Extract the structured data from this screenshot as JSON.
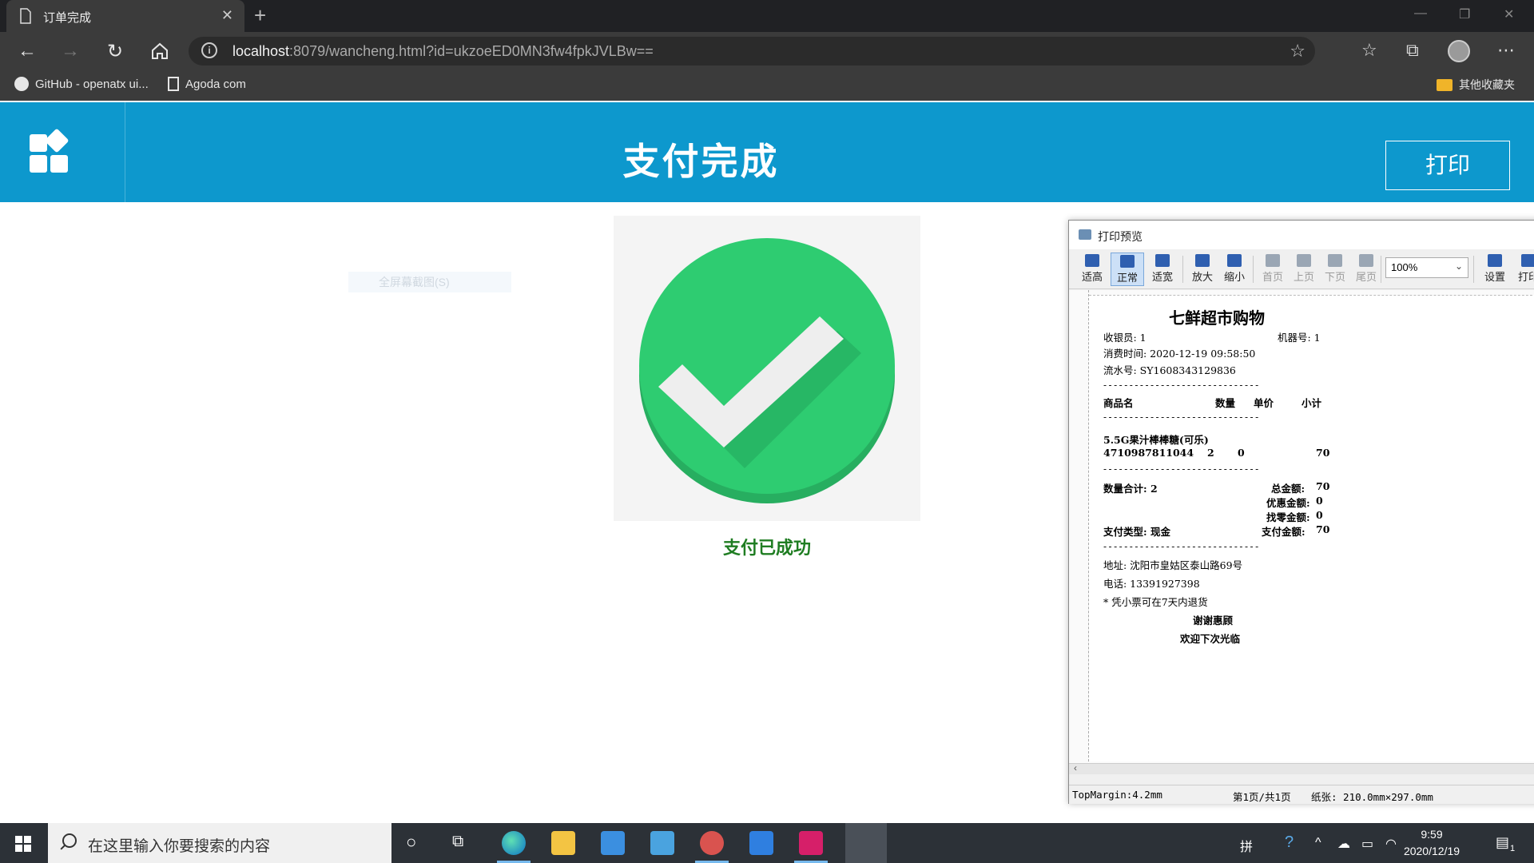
{
  "browser": {
    "tab_title": "订单完成",
    "url_host": "localhost",
    "url_rest": ":8079/wancheng.html?id=ukzoeED0MN3fw4fpkJVLBw==",
    "bookmarks": [
      "GitHub - openatx ui...",
      "Agoda com"
    ],
    "other_bookmarks": "其他收藏夹"
  },
  "page": {
    "title": "支付完成",
    "print_button": "打印",
    "faint_label": "全屏幕截图(S)",
    "success_message": "支付已成功",
    "colors": {
      "header": "#0d98cd",
      "check_green": "#2ecc71",
      "success_text": "#1f7d22"
    }
  },
  "print_preview": {
    "window_title": "打印预览",
    "toolbar": [
      {
        "label": "适高",
        "icon": "fit-height-icon",
        "state": "normal"
      },
      {
        "label": "正常",
        "icon": "normal-size-icon",
        "state": "active"
      },
      {
        "label": "适宽",
        "icon": "fit-width-icon",
        "state": "normal"
      },
      {
        "label": "放大",
        "icon": "zoom-in-icon",
        "state": "normal"
      },
      {
        "label": "缩小",
        "icon": "zoom-out-icon",
        "state": "normal"
      },
      {
        "label": "首页",
        "icon": "first-page-icon",
        "state": "disabled"
      },
      {
        "label": "上页",
        "icon": "prev-page-icon",
        "state": "disabled"
      },
      {
        "label": "下页",
        "icon": "next-page-icon",
        "state": "disabled"
      },
      {
        "label": "尾页",
        "icon": "last-page-icon",
        "state": "disabled"
      },
      {
        "label": "设置",
        "icon": "settings-icon",
        "state": "normal"
      },
      {
        "label": "打印",
        "icon": "printer-icon",
        "state": "normal"
      }
    ],
    "zoom": "100%",
    "receipt": {
      "store": "七鲜超市购物",
      "cashier": "收银员: 1",
      "machine": "机器号: 1",
      "time": "消费时间: 2020-12-19 09:58:50",
      "serial": "流水号: SY1608343129836",
      "dashes": "------------------------------",
      "header": {
        "name": "商品名",
        "qty": "数量",
        "price": "单价",
        "subtotal": "小计"
      },
      "item": {
        "name": "5.5G果汁棒棒糖(可乐)",
        "code": "4710987811044",
        "qty": "2",
        "price": "0",
        "subtotal": "70"
      },
      "qty_total": "数量合计: 2",
      "total_label": "总金额:",
      "total": "70",
      "discount_label": "优惠金额:",
      "discount": "0",
      "change_label": "找零金额:",
      "change": "0",
      "pay_type": "支付类型: 现金",
      "paid_label": "支付金额:",
      "paid": "70",
      "address": "地址: 沈阳市皇姑区泰山路69号",
      "phone": "电话: 13391927398",
      "note": "* 凭小票可在7天内退货",
      "thanks": "谢谢惠顾",
      "welcome": "欢迎下次光临"
    },
    "status": {
      "margin": "TopMargin:4.2mm",
      "page": "第1页/共1页",
      "paper": "纸张: 210.0mm×297.0mm"
    }
  },
  "taskbar": {
    "search_placeholder": "在这里输入你要搜索的内容",
    "time": "9:59",
    "date": "2020/12/19",
    "notification_count": "1",
    "ime": "拼"
  }
}
